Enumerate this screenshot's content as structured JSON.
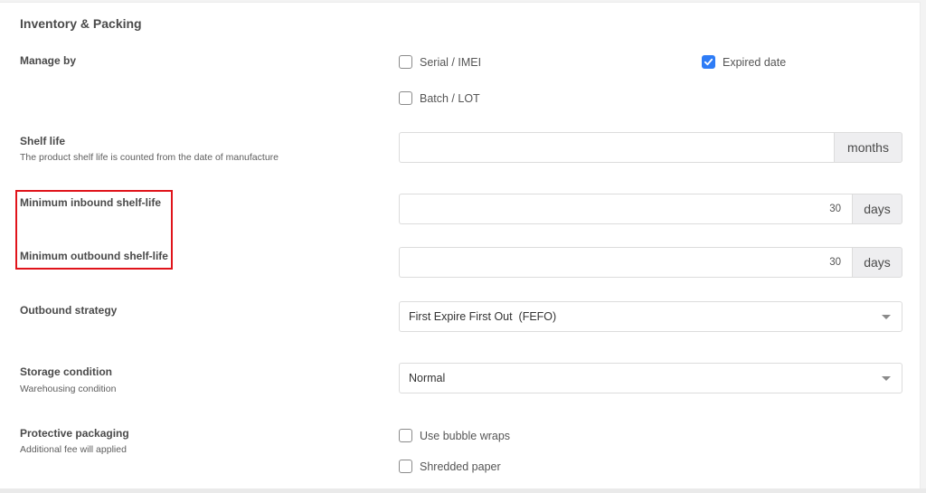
{
  "section": {
    "title": "Inventory & Packing"
  },
  "manage_by": {
    "label": "Manage by",
    "options": [
      {
        "label": "Serial / IMEI",
        "checked": false
      },
      {
        "label": "Expired date",
        "checked": true
      },
      {
        "label": "Batch / LOT",
        "checked": false
      }
    ]
  },
  "shelf_life": {
    "label": "Shelf life",
    "description": "The product shelf life is counted from the date of manufacture",
    "value": "",
    "unit": "months"
  },
  "min_inbound": {
    "label": "Minimum inbound shelf-life",
    "value": "30",
    "unit": "days"
  },
  "min_outbound": {
    "label": "Minimum outbound shelf-life",
    "value": "30",
    "unit": "days"
  },
  "outbound_strategy": {
    "label": "Outbound strategy",
    "selected": "First Expire First Out  (FEFO)"
  },
  "storage_condition": {
    "label": "Storage condition",
    "description": "Warehousing condition",
    "selected": "Normal"
  },
  "protective_packaging": {
    "label": "Protective packaging",
    "description": "Additional fee will applied",
    "options": [
      {
        "label": "Use bubble wraps",
        "checked": false
      },
      {
        "label": "Shredded paper",
        "checked": false
      }
    ]
  },
  "colors": {
    "accent": "#2e7cf6",
    "highlight": "#e0141b"
  }
}
